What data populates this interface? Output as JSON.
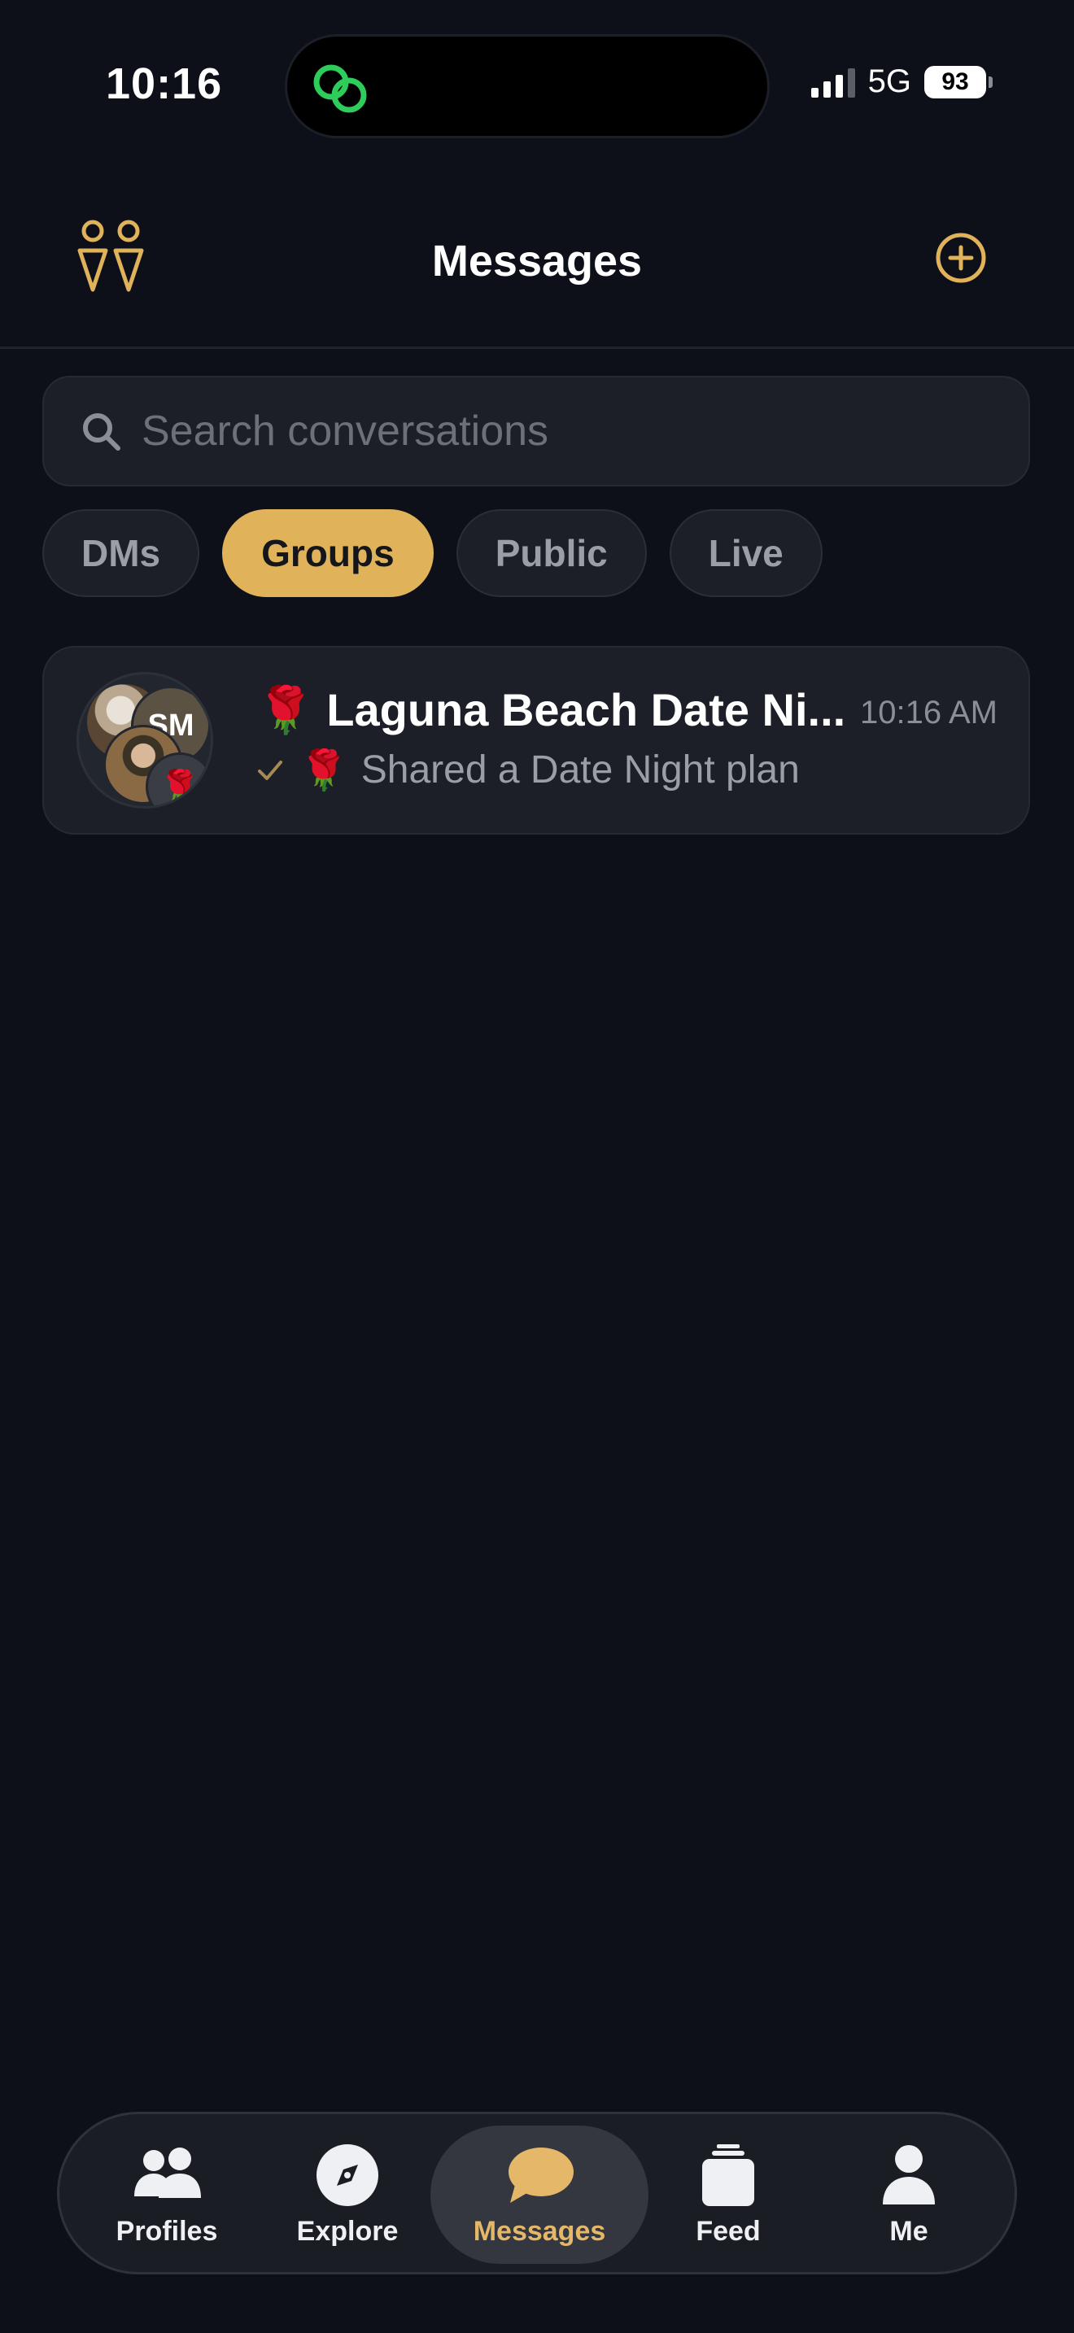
{
  "status_bar": {
    "time": "10:16",
    "network": "5G",
    "battery": "93"
  },
  "header": {
    "title": "Messages"
  },
  "search": {
    "placeholder": "Search conversations",
    "value": ""
  },
  "tabs": [
    {
      "label": "DMs",
      "active": false
    },
    {
      "label": "Groups",
      "active": true
    },
    {
      "label": "Public",
      "active": false
    },
    {
      "label": "Live",
      "active": false
    }
  ],
  "conversations": [
    {
      "title": "🌹 Laguna Beach Date Ni...",
      "time": "10:16 AM",
      "preview_emoji": "🌹",
      "preview": "Shared a Date Night plan",
      "avatar_initials": "SM",
      "avatar_emoji": "🌹"
    }
  ],
  "bottom_nav": [
    {
      "label": "Profiles",
      "icon": "people-icon",
      "active": false
    },
    {
      "label": "Explore",
      "icon": "compass-icon",
      "active": false
    },
    {
      "label": "Messages",
      "icon": "chat-bubble-icon",
      "active": true
    },
    {
      "label": "Feed",
      "icon": "cards-stack-icon",
      "active": false
    },
    {
      "label": "Me",
      "icon": "person-icon",
      "active": false
    }
  ],
  "colors": {
    "background": "#0d1018",
    "accent": "#e0b35b",
    "card": "#1c1f27",
    "island_icon": "#2ecc5a"
  }
}
